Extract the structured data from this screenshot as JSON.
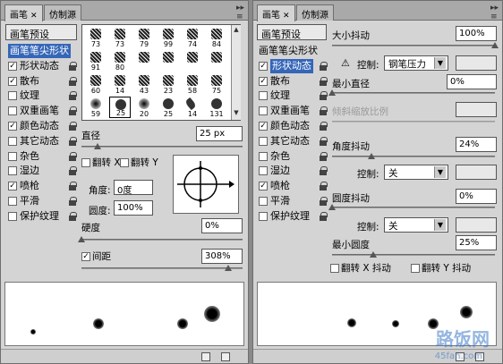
{
  "left": {
    "tabs": [
      {
        "label": "画笔"
      },
      {
        "label": "仿制源"
      }
    ],
    "preset_button": "画笔预设",
    "list": [
      {
        "label": "画笔笔尖形状",
        "checkbox": false,
        "checked": false,
        "selected": true,
        "lock": false
      },
      {
        "label": "形状动态",
        "checkbox": true,
        "checked": true,
        "selected": false,
        "lock": true
      },
      {
        "label": "散布",
        "checkbox": true,
        "checked": true,
        "selected": false,
        "lock": true
      },
      {
        "label": "纹理",
        "checkbox": true,
        "checked": false,
        "selected": false,
        "lock": true
      },
      {
        "label": "双重画笔",
        "checkbox": true,
        "checked": false,
        "selected": false,
        "lock": true
      },
      {
        "label": "颜色动态",
        "checkbox": true,
        "checked": true,
        "selected": false,
        "lock": true
      },
      {
        "label": "其它动态",
        "checkbox": true,
        "checked": false,
        "selected": false,
        "lock": true
      },
      {
        "label": "杂色",
        "checkbox": true,
        "checked": false,
        "selected": false,
        "lock": true
      },
      {
        "label": "湿边",
        "checkbox": true,
        "checked": false,
        "selected": false,
        "lock": true
      },
      {
        "label": "喷枪",
        "checkbox": true,
        "checked": true,
        "selected": false,
        "lock": true
      },
      {
        "label": "平滑",
        "checkbox": true,
        "checked": false,
        "selected": false,
        "lock": true
      },
      {
        "label": "保护纹理",
        "checkbox": true,
        "checked": false,
        "selected": false,
        "lock": true
      }
    ],
    "brush_numbers": [
      "73",
      "73",
      "79",
      "99",
      "74",
      "84",
      "91",
      "80",
      "",
      "",
      "",
      "",
      "60",
      "14",
      "43",
      "23",
      "58",
      "75",
      "59",
      "25",
      "20",
      "25",
      "14",
      "131"
    ],
    "diameter_label": "直径",
    "diameter_value": "25 px",
    "diameter_fraction": 0.1,
    "flip_x": "翻转 X",
    "flip_y": "翻转 Y",
    "angle_label": "角度:",
    "angle_value": "0度",
    "roundness_label": "圆度:",
    "roundness_value": "100%",
    "hardness_label": "硬度",
    "hardness_value": "0%",
    "hardness_fraction": 0.0,
    "spacing_label": "间距",
    "spacing_checked": true,
    "spacing_value": "308%",
    "spacing_fraction": 0.91
  },
  "right": {
    "tabs": [
      {
        "label": "画笔"
      },
      {
        "label": "仿制源"
      }
    ],
    "preset_button": "画笔预设",
    "list": [
      {
        "label": "画笔笔尖形状",
        "checkbox": false,
        "checked": false,
        "selected": false,
        "lock": false
      },
      {
        "label": "形状动态",
        "checkbox": true,
        "checked": true,
        "selected": true,
        "lock": true
      },
      {
        "label": "散布",
        "checkbox": true,
        "checked": true,
        "selected": false,
        "lock": true
      },
      {
        "label": "纹理",
        "checkbox": true,
        "checked": false,
        "selected": false,
        "lock": true
      },
      {
        "label": "双重画笔",
        "checkbox": true,
        "checked": false,
        "selected": false,
        "lock": true
      },
      {
        "label": "颜色动态",
        "checkbox": true,
        "checked": true,
        "selected": false,
        "lock": true
      },
      {
        "label": "其它动态",
        "checkbox": true,
        "checked": false,
        "selected": false,
        "lock": true
      },
      {
        "label": "杂色",
        "checkbox": true,
        "checked": false,
        "selected": false,
        "lock": true
      },
      {
        "label": "湿边",
        "checkbox": true,
        "checked": false,
        "selected": false,
        "lock": true
      },
      {
        "label": "喷枪",
        "checkbox": true,
        "checked": true,
        "selected": false,
        "lock": true
      },
      {
        "label": "平滑",
        "checkbox": true,
        "checked": false,
        "selected": false,
        "lock": true
      },
      {
        "label": "保护纹理",
        "checkbox": true,
        "checked": false,
        "selected": false,
        "lock": true
      }
    ],
    "size_jitter_label": "大小抖动",
    "size_jitter_value": "100%",
    "size_jitter_fraction": 1.0,
    "control_label": "控制:",
    "size_control": "钢笔压力",
    "min_diameter_label": "最小直径",
    "min_diameter_value": "0%",
    "min_diameter_fraction": 0.0,
    "tilt_scale_label": "倾斜缩放比例",
    "angle_jitter_label": "角度抖动",
    "angle_jitter_value": "24%",
    "angle_jitter_fraction": 0.24,
    "angle_control": "关",
    "roundness_jitter_label": "圆度抖动",
    "roundness_jitter_value": "0%",
    "roundness_jitter_fraction": 0.0,
    "roundness_control": "关",
    "min_roundness_label": "最小圆度",
    "min_roundness_value": "25%",
    "min_roundness_fraction": 0.25,
    "flip_x_jitter": "翻转 X 抖动",
    "flip_y_jitter": "翻转 Y 抖动",
    "watermark": "路饭网",
    "watermark_url": "45fan.com"
  }
}
